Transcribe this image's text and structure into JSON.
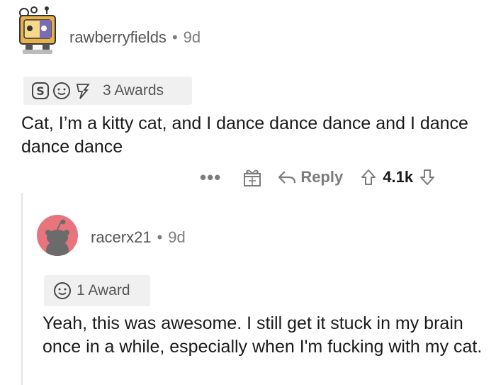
{
  "comment": {
    "username": "rawberryfields",
    "separator": "•",
    "age": "9d",
    "awards_label": "3 Awards",
    "body": "Cat, I’m a kitty cat, and I dance dance dance and I dance dance dance",
    "more_label": "•••",
    "reply_label": "Reply",
    "vote_count": "4.1k"
  },
  "reply": {
    "username": "racerx21",
    "separator": "•",
    "age": "9d",
    "awards_label": "1 Award",
    "body": "Yeah, this was awesome. I still get it stuck in my brain once in a while, especially when I'm fucking with my cat."
  },
  "colors": {
    "text": "#1a1a1b",
    "muted": "#7c7c7c",
    "award_bg": "#f0f0f0",
    "avatar2_bg": "#e8747c",
    "thread_line": "#e4e4e4"
  },
  "icons": [
    "silver-award-icon",
    "wholesome-award-icon",
    "helpful-award-icon",
    "gift-icon",
    "reply-arrow-icon",
    "upvote-icon",
    "downvote-icon"
  ]
}
